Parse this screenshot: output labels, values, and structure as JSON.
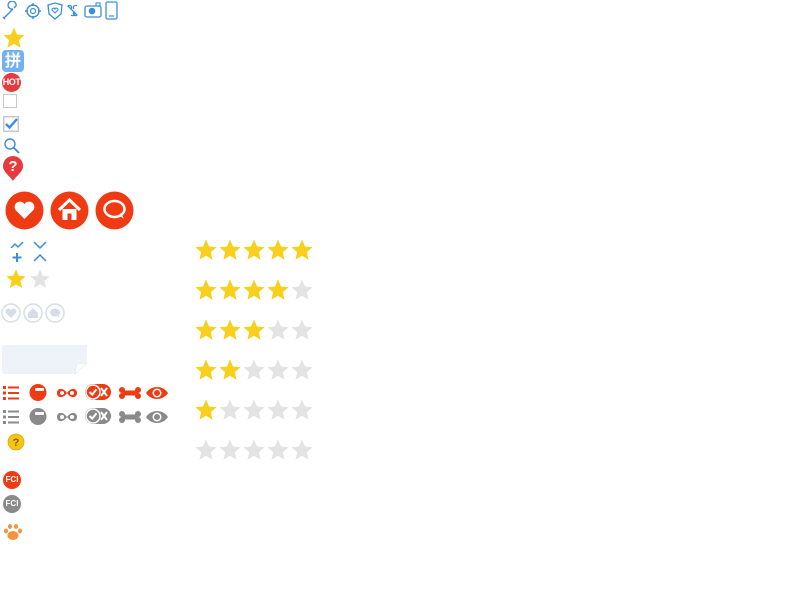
{
  "colors": {
    "blue_line": "#3b8fd8",
    "star_gold": "#f8cf1a",
    "star_gray": "#e3e3e3",
    "red": "#ee3b13",
    "gray": "#8a8a8a",
    "light_gray_blue": "#d5dde8",
    "paw_orange": "#f5923e",
    "question_yellow": "#f4c515"
  },
  "top_icons": [
    "wrench-icon",
    "gear-icon",
    "shield-heart-icon",
    "link-icon",
    "camera-icon",
    "phone-icon"
  ],
  "badges": {
    "pin": "拼",
    "hot": "HOT",
    "fc_red": "FCI",
    "fc_gray": "FCI"
  },
  "checkboxes": {
    "unchecked": false,
    "checked": true
  },
  "circle_buttons": [
    "heart-icon",
    "home-icon",
    "chat-bubble-icon"
  ],
  "small_rating_value": 1,
  "small_rating_max": 2,
  "ratings": [
    {
      "value": 5,
      "max": 5
    },
    {
      "value": 4,
      "max": 5
    },
    {
      "value": 3,
      "max": 5
    },
    {
      "value": 2,
      "max": 5
    },
    {
      "value": 1,
      "max": 5
    },
    {
      "value": 0,
      "max": 5
    }
  ],
  "action_icons_red": [
    "list-icon",
    "minus-circle-icon",
    "infinity-icon",
    "check-x-toggle-icon",
    "bone-icon",
    "eye-icon"
  ],
  "action_icons_gray": [
    "list-icon",
    "minus-circle-icon",
    "infinity-icon",
    "check-x-toggle-icon",
    "bone-icon",
    "eye-icon"
  ]
}
